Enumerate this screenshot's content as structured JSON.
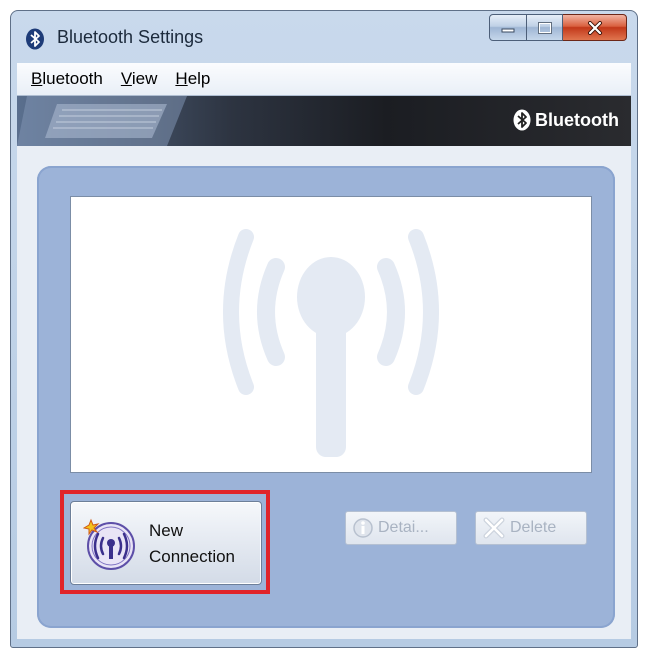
{
  "window": {
    "title": "Bluetooth Settings"
  },
  "menu": {
    "items": [
      {
        "accel": "B",
        "rest": "luetooth"
      },
      {
        "accel": "V",
        "rest": "iew"
      },
      {
        "accel": "H",
        "rest": "elp"
      }
    ]
  },
  "banner": {
    "brand": "Bluetooth"
  },
  "buttons": {
    "new_connection_line1": "New",
    "new_connection_line2": "Connection",
    "details": "Detai...",
    "delete": "Delete"
  },
  "icons": {
    "app": "bluetooth-icon",
    "minimize": "minimize-icon",
    "maximize": "maximize-icon",
    "close": "close-icon",
    "new_connection": "bluetooth-radio-icon",
    "details": "info-icon",
    "delete": "delete-x-icon"
  },
  "colors": {
    "highlight_border": "#e0242a",
    "panel": "#9cb3d8",
    "close_button": "#c2381a"
  }
}
